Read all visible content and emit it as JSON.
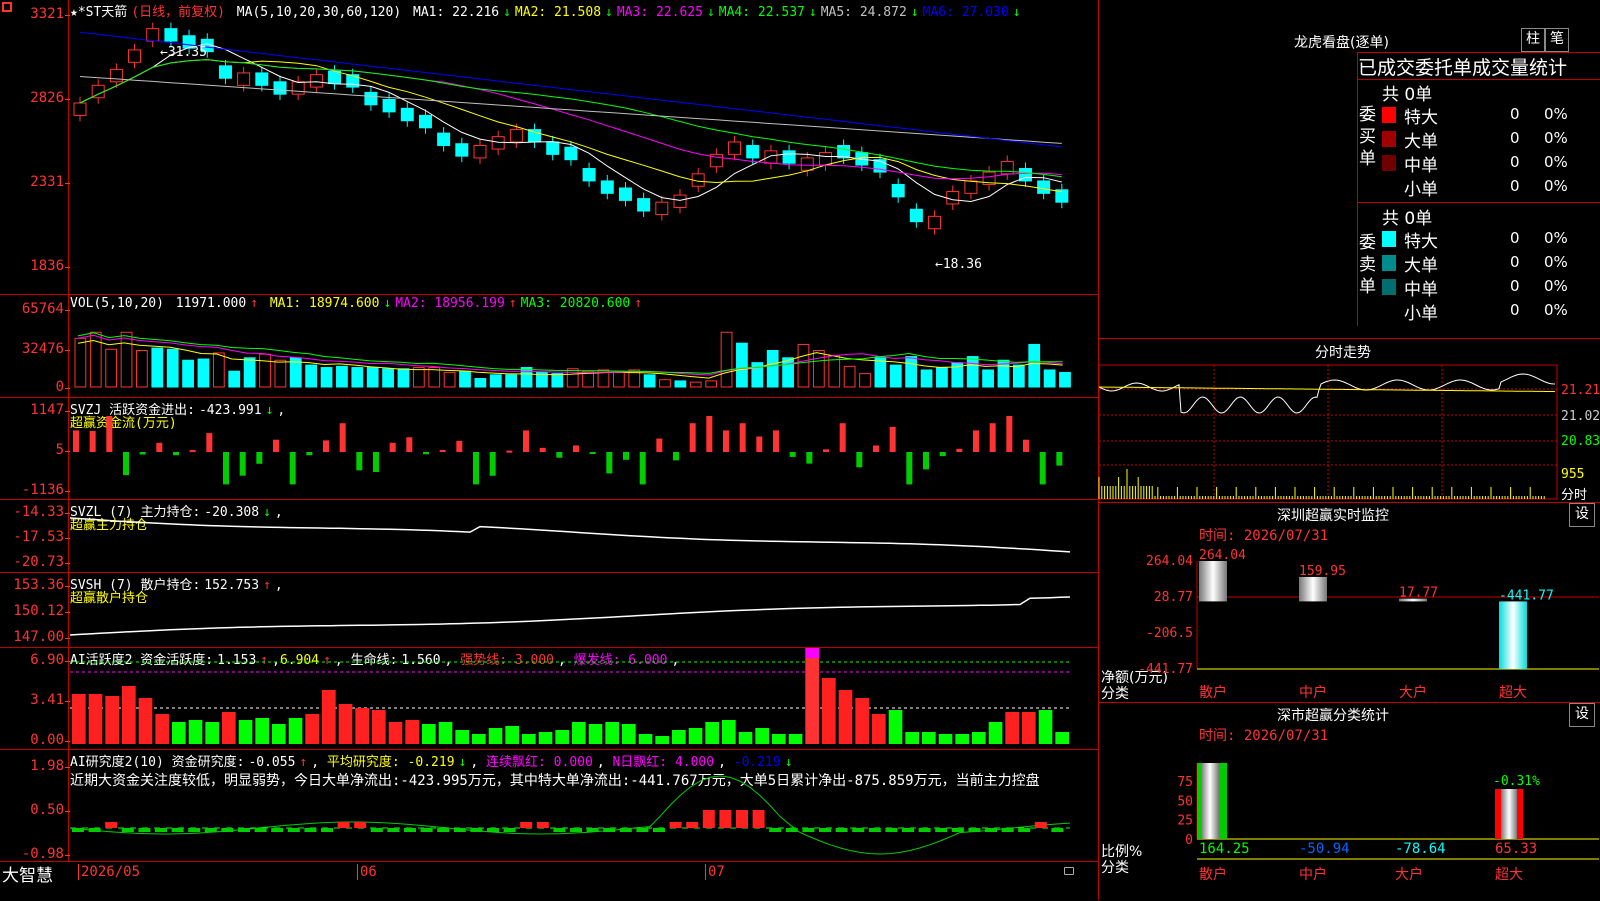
{
  "main": {
    "stock": "★*ST天箭",
    "mode": "(日线，前复权)",
    "ma_label": "MA(5,10,20,30,60,120)",
    "ma": [
      {
        "label": "MA1:",
        "value": "22.216",
        "arrow": "↓",
        "color": "#ffffff"
      },
      {
        "label": "MA2:",
        "value": "21.508",
        "arrow": "↓",
        "color": "#ffff00"
      },
      {
        "label": "MA3:",
        "value": "22.625",
        "arrow": "↓",
        "color": "#ff00ff"
      },
      {
        "label": "MA4:",
        "value": "22.537",
        "arrow": "↓",
        "color": "#00ff00"
      },
      {
        "label": "MA5:",
        "value": "24.872",
        "arrow": "↓",
        "color": "#c0c0c0"
      },
      {
        "label": "MA6:",
        "value": "27.030",
        "arrow": "↓",
        "color": "#0000ff"
      }
    ],
    "y_ticks": [
      "3321",
      "2826",
      "2331",
      "1836"
    ],
    "high_label": "31.35",
    "low_label": "18.36"
  },
  "vol": {
    "label": "VOL(5,10,20)",
    "value": "11971.000",
    "ma": [
      {
        "label": "MA1:",
        "value": "18974.600",
        "arrow": "↓",
        "color": "#ffff00"
      },
      {
        "label": "MA2:",
        "value": "18956.199",
        "arrow": "↑",
        "color": "#ff00ff"
      },
      {
        "label": "MA3:",
        "value": "20820.600",
        "arrow": "↑",
        "color": "#00ff00"
      }
    ],
    "y_ticks": [
      "65764",
      "32476",
      "0"
    ]
  },
  "svzj": {
    "label": "SVZJ  活跃资金进出:",
    "value": "-423.991",
    "sub": "超赢资金流(万元)",
    "y_ticks": [
      "1147",
      "5",
      "-1136"
    ]
  },
  "svzl": {
    "label": "SVZL (7) 主力持仓:",
    "value": "-20.308",
    "sub": "超赢主力持仓",
    "y_ticks": [
      "-14.33",
      "-17.53",
      "-20.73"
    ]
  },
  "svsh": {
    "label": "SVSH (7) 散户持仓:",
    "value": "152.753",
    "sub": "超赢散户持仓",
    "y_ticks": [
      "153.36",
      "150.12",
      "147.00"
    ]
  },
  "ai1": {
    "label": "AI活跃度2 资金活跃度:",
    "v1": "1.153",
    "v2": "6.904",
    "life_label": "生命线:",
    "life": "1.560",
    "strong": "强势线: 3.000",
    "burst": "爆发线: 6.000",
    "y_ticks": [
      "6.90",
      "3.41",
      "0.00"
    ]
  },
  "ai2": {
    "label": "AI研究度2(10) 资金研究度:",
    "v1": "-0.055",
    "avg": "平均研究度: -0.219",
    "red": "连续飘红: 0.000",
    "nred": "N日飘红: 4.000",
    "last": "-0.219",
    "comment": "近期大资金关注度较低，明显弱势，今日大单净流出:-423.995万元，其中特大单净流出:-441.767万元，大单5日累计净出-875.859万元，当前主力控盘",
    "y_ticks": [
      "1.98",
      "0.50",
      "-0.98"
    ]
  },
  "bottom": {
    "brand": "大智慧",
    "dates": [
      "2026/05",
      "06",
      "07"
    ]
  },
  "right": {
    "lhb_title": "龙虎看盘(逐单)",
    "btn_bar": "柱",
    "btn_pen": "笔",
    "tabs": [
      "已成交",
      "委托单",
      "成交量统计"
    ],
    "buy_total": "共 0单",
    "buy_side": "委买单",
    "sell_total": "共 0单",
    "sell_side": "委卖单",
    "buy_rows": [
      {
        "name": "特大",
        "n": "0",
        "pct": "0%",
        "color": "#ff0000"
      },
      {
        "name": "大单",
        "n": "0",
        "pct": "0%",
        "color": "#a00000"
      },
      {
        "name": "中单",
        "n": "0",
        "pct": "0%",
        "color": "#700000"
      },
      {
        "name": "小单",
        "n": "0",
        "pct": "0%",
        "color": "#000000"
      }
    ],
    "sell_rows": [
      {
        "name": "特大",
        "n": "0",
        "pct": "0%",
        "color": "#00ffff"
      },
      {
        "name": "大单",
        "n": "0",
        "pct": "0%",
        "color": "#008c8c"
      },
      {
        "name": "中单",
        "n": "0",
        "pct": "0%",
        "color": "#006e6e"
      },
      {
        "name": "小单",
        "n": "0",
        "pct": "0%",
        "color": "#000000"
      }
    ],
    "intraday_title": "分时走势",
    "intraday_ticks": [
      "21.21",
      "21.02",
      "20.83",
      "955",
      "分时"
    ],
    "sz_title": "深圳超赢实时监控",
    "sz_btn": "设",
    "sz_time": "时间: 2026/07/31",
    "sz_ticks": [
      "264.04",
      "28.77",
      "-206.5",
      "-441.77"
    ],
    "sz_ylabel": "净额(万元)",
    "sz_xlabel": "分类",
    "sz_bars": [
      {
        "name": "散户",
        "value": 264.04,
        "label": "264.04"
      },
      {
        "name": "中户",
        "value": 159.95,
        "label": "159.95"
      },
      {
        "name": "大户",
        "value": 17.77,
        "label": "17.77"
      },
      {
        "name": "超大",
        "value": -441.77,
        "label": "-441.77"
      }
    ],
    "cls_title": "深市超赢分类统计",
    "cls_btn": "设",
    "cls_time": "时间: 2026/07/31",
    "cls_ticks": [
      "75",
      "50",
      "25",
      "0"
    ],
    "cls_ylabel": "比例%",
    "cls_xlabel": "分类",
    "cls_top_label": "-0.31%",
    "cls_values": [
      "164.25",
      "-50.94",
      "-78.64",
      "65.33"
    ],
    "cls_names": [
      "散户",
      "中户",
      "大户",
      "超大"
    ]
  },
  "chart_data": [
    {
      "type": "candlestick",
      "title": "★*ST天箭 (日线，前复权)",
      "ylim": [
        18.36,
        31.35
      ],
      "x_labels": [
        "2026/05",
        "06",
        "07"
      ],
      "close": [
        27.0,
        28.0,
        28.9,
        30.0,
        31.2,
        30.5,
        30.1,
        29.9,
        28.4,
        28.7,
        28.0,
        27.5,
        28.2,
        28.6,
        28.1,
        27.9,
        26.9,
        26.5,
        26.0,
        25.6,
        24.6,
        24.0,
        24.6,
        25.1,
        25.5,
        24.8,
        24.1,
        23.8,
        22.6,
        21.9,
        21.5,
        20.9,
        21.4,
        21.8,
        23.0,
        24.1,
        24.8,
        23.9,
        24.3,
        23.6,
        23.9,
        24.2,
        23.9,
        23.5,
        23.1,
        21.7,
        20.3,
        20.6,
        22.0,
        22.6,
        23.1,
        23.7,
        22.6,
        21.9,
        21.4
      ],
      "up": [
        true,
        true,
        true,
        true,
        true,
        false,
        false,
        false,
        false,
        true,
        false,
        false,
        true,
        true,
        false,
        false,
        false,
        false,
        false,
        false,
        false,
        false,
        true,
        true,
        true,
        false,
        false,
        false,
        false,
        false,
        false,
        false,
        true,
        true,
        true,
        true,
        true,
        false,
        true,
        false,
        true,
        true,
        false,
        false,
        false,
        false,
        false,
        true,
        true,
        true,
        true,
        true,
        false,
        false,
        false
      ]
    },
    {
      "type": "bar",
      "title": "VOL(5,10,20)",
      "ylim": [
        0,
        65764
      ],
      "values": [
        40000,
        45000,
        31000,
        45000,
        30000,
        32000,
        31000,
        22000,
        23000,
        28000,
        13000,
        24000,
        27000,
        22000,
        24000,
        18000,
        16000,
        17000,
        16000,
        16000,
        15000,
        15000,
        16000,
        16000,
        12000,
        13000,
        7000,
        10000,
        10000,
        16000,
        12000,
        11000,
        15000,
        13000,
        14000,
        13000,
        14000,
        10000,
        6000,
        5000,
        4000,
        5000,
        45000,
        36000,
        20000,
        30000,
        24000,
        35000,
        30000,
        26000,
        17000,
        11000,
        24000,
        18000,
        25000,
        14000,
        16000,
        20000,
        25000,
        14000,
        22000,
        18000,
        35000,
        14000,
        11971
      ]
    }
  ]
}
